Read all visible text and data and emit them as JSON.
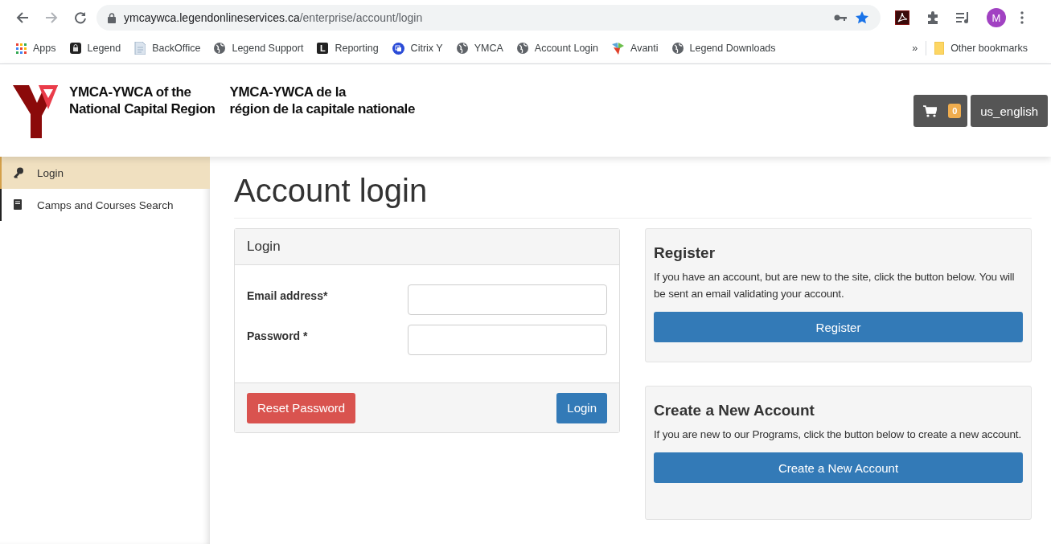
{
  "browser": {
    "url_host": "ymcaywca.legendonlineservices.ca",
    "url_path": "/enterprise/account/login",
    "profile_initial": "M",
    "bookmarks": [
      {
        "label": "Apps",
        "kind": "apps"
      },
      {
        "label": "Legend",
        "kind": "lock"
      },
      {
        "label": "BackOffice",
        "kind": "doc"
      },
      {
        "label": "Legend Support",
        "kind": "globe"
      },
      {
        "label": "Reporting",
        "kind": "letter"
      },
      {
        "label": "Citrix Y",
        "kind": "citrix"
      },
      {
        "label": "YMCA",
        "kind": "globe"
      },
      {
        "label": "Account Login",
        "kind": "globe"
      },
      {
        "label": "Avanti",
        "kind": "avanti"
      },
      {
        "label": "Legend Downloads",
        "kind": "globe"
      }
    ],
    "more": "»",
    "other_bookmarks": "Other bookmarks",
    "letter_icon": "L"
  },
  "header": {
    "org_en": [
      "YMCA-YWCA of the",
      "National Capital Region"
    ],
    "org_fr": [
      "YMCA-YWCA de la",
      "région de la capitale nationale"
    ],
    "cart_count": "0",
    "language": "us_english"
  },
  "sidebar": {
    "items": [
      {
        "label": "Login",
        "kind": "key",
        "selected": true
      },
      {
        "label": "Camps and Courses Search",
        "kind": "book",
        "selected": false
      }
    ]
  },
  "page_title": "Account login",
  "login_panel": {
    "title": "Login",
    "fields": [
      {
        "label": "Email address*"
      },
      {
        "label": "Password *"
      }
    ],
    "reset_button": "Reset Password",
    "login_button": "Login"
  },
  "side_panels": [
    {
      "title": "Register",
      "text": "If you have an account, but are new to the site, click the button below. You will be sent an email validating your account.",
      "button": "Register"
    },
    {
      "title": "Create a New Account",
      "text": "If you are new to our Programs, click the button below to create a new account.",
      "button": "Create a New Account"
    }
  ]
}
